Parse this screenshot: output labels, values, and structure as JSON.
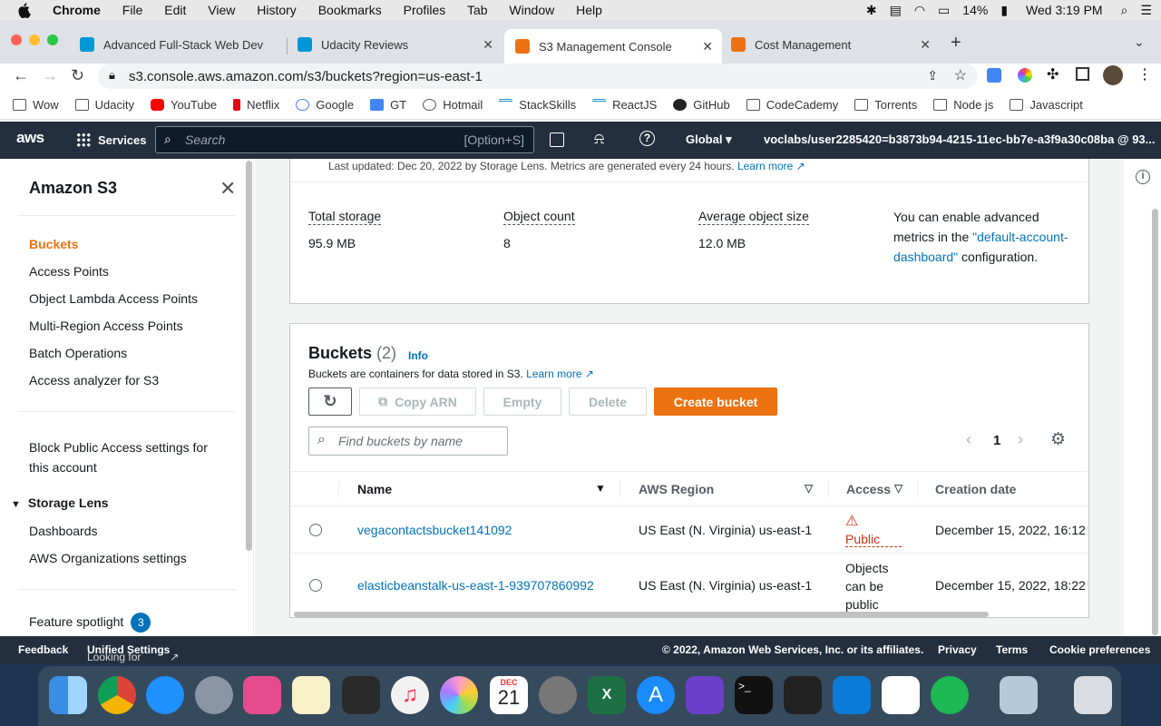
{
  "mac_menu": {
    "app": "Chrome",
    "items": [
      "File",
      "Edit",
      "View",
      "History",
      "Bookmarks",
      "Profiles",
      "Tab",
      "Window",
      "Help"
    ],
    "battery": "14%",
    "clock": "Wed 3:19 PM"
  },
  "tabs": [
    {
      "title": "Advanced Full-Stack Web Dev",
      "color": "#0097d6"
    },
    {
      "title": "Udacity Reviews",
      "color": "#0097d6"
    },
    {
      "title": "S3 Management Console",
      "color": "#ec7211"
    },
    {
      "title": "Cost Management",
      "color": "#ec7211"
    }
  ],
  "url": "s3.console.aws.amazon.com/s3/buckets?region=us-east-1",
  "bookmarks": [
    "Wow",
    "Udacity",
    "YouTube",
    "Netflix",
    "Google",
    "GT",
    "Hotmail",
    "StackSkills",
    "ReactJS",
    "GitHub",
    "CodeCademy",
    "Torrents",
    "Node js",
    "Javascript"
  ],
  "aws_nav": {
    "logo": "aws",
    "services": "Services",
    "search_placeholder": "Search",
    "search_hint": "[Option+S]",
    "region": "Global",
    "user": "voclabs/user2285420=b3873b94-4215-11ec-bb7e-a3f9a30c08ba @ 93..."
  },
  "sidebar": {
    "title": "Amazon S3",
    "items": [
      "Buckets",
      "Access Points",
      "Object Lambda Access Points",
      "Multi-Region Access Points",
      "Batch Operations",
      "Access analyzer for S3"
    ],
    "block_public": [
      "Block Public Access settings for",
      "this account"
    ],
    "storage_lens": "Storage Lens",
    "storage_lens_items": [
      "Dashboards",
      "AWS Organizations settings"
    ],
    "feature_spotlight": "Feature spotlight",
    "feature_badge": "3"
  },
  "lens": {
    "updated": "Last updated: Dec 20, 2022 by Storage Lens. Metrics are generated every 24 hours.",
    "learn_more": "Learn more",
    "metrics": [
      {
        "label": "Total storage",
        "value": "95.9 MB"
      },
      {
        "label": "Object count",
        "value": "8"
      },
      {
        "label": "Average object size",
        "value": "12.0 MB"
      }
    ],
    "adv_1": "You can enable advanced metrics in the",
    "adv_link": "\"default-account-dashboard\"",
    "adv_2": "configuration."
  },
  "buckets": {
    "title": "Buckets",
    "count": "(2)",
    "info": "Info",
    "desc": "Buckets are containers for data stored in S3.",
    "learn_more": "Learn more",
    "buttons": {
      "copy_arn": "Copy ARN",
      "empty": "Empty",
      "delete": "Delete",
      "create": "Create bucket"
    },
    "find_placeholder": "Find buckets by name",
    "page": "1",
    "columns": [
      "Name",
      "AWS Region",
      "Access",
      "Creation date"
    ],
    "rows": [
      {
        "name": "vegacontactsbucket141092",
        "region": "US East (N. Virginia) us-east-1",
        "access": "Public",
        "created": "December 15, 2022, 16:12"
      },
      {
        "name": "elasticbeanstalk-us-east-1-939707860992",
        "region": "US East (N. Virginia) us-east-1",
        "access": "Objects can be public",
        "created": "December 15, 2022, 18:22"
      }
    ]
  },
  "footer": {
    "feedback": "Feedback",
    "lang_q": "Looking for language selection? Find it in the new",
    "unified": "Unified Settings",
    "copyright": "© 2022, Amazon Web Services, Inc. or its affiliates.",
    "privacy": "Privacy",
    "terms": "Terms",
    "cookies": "Cookie preferences"
  },
  "dock_date": {
    "month": "DEC",
    "day": "21"
  }
}
